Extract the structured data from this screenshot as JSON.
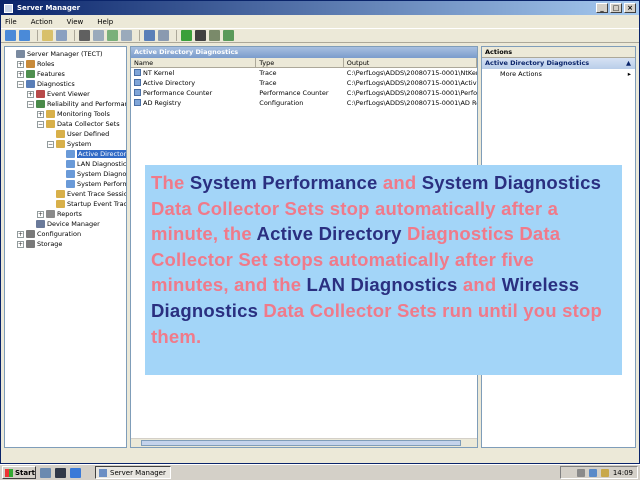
{
  "window": {
    "title": "Server Manager"
  },
  "menu": [
    "File",
    "Action",
    "View",
    "Help"
  ],
  "tree": [
    {
      "label": "Server Manager (TECT)",
      "indent": 0,
      "exp": "",
      "icon": "#7a8aa0"
    },
    {
      "label": "Roles",
      "indent": 1,
      "exp": "+",
      "icon": "#c88a3a"
    },
    {
      "label": "Features",
      "indent": 1,
      "exp": "+",
      "icon": "#4f8f4f"
    },
    {
      "label": "Diagnostics",
      "indent": 1,
      "exp": "-",
      "icon": "#5a7fb8"
    },
    {
      "label": "Event Viewer",
      "indent": 2,
      "exp": "+",
      "icon": "#b84a4a"
    },
    {
      "label": "Reliability and Performance",
      "indent": 2,
      "exp": "-",
      "icon": "#4a8a4a"
    },
    {
      "label": "Monitoring Tools",
      "indent": 3,
      "exp": "+",
      "icon": "#d8b04a"
    },
    {
      "label": "Data Collector Sets",
      "indent": 3,
      "exp": "-",
      "icon": "#d8b04a"
    },
    {
      "label": "User Defined",
      "indent": 4,
      "exp": "",
      "icon": "#d8b04a"
    },
    {
      "label": "System",
      "indent": 4,
      "exp": "-",
      "icon": "#d8b04a"
    },
    {
      "label": "Active Directory",
      "indent": 5,
      "exp": "",
      "icon": "#6a9ad8",
      "selected": true
    },
    {
      "label": "LAN Diagnostics",
      "indent": 5,
      "exp": "",
      "icon": "#6a9ad8"
    },
    {
      "label": "System Diagnostics",
      "indent": 5,
      "exp": "",
      "icon": "#6a9ad8"
    },
    {
      "label": "System Performance",
      "indent": 5,
      "exp": "",
      "icon": "#6a9ad8"
    },
    {
      "label": "Event Trace Sessions",
      "indent": 4,
      "exp": "",
      "icon": "#d8b04a"
    },
    {
      "label": "Startup Event Trace Sessions",
      "indent": 4,
      "exp": "",
      "icon": "#d8b04a"
    },
    {
      "label": "Reports",
      "indent": 3,
      "exp": "+",
      "icon": "#8a8a8a"
    },
    {
      "label": "Device Manager",
      "indent": 2,
      "exp": "",
      "icon": "#6a7a9a"
    },
    {
      "label": "Configuration",
      "indent": 1,
      "exp": "+",
      "icon": "#7a7a7a"
    },
    {
      "label": "Storage",
      "indent": 1,
      "exp": "+",
      "icon": "#7a7a7a"
    }
  ],
  "center": {
    "header": "Active Directory Diagnostics",
    "columns": [
      "Name",
      "Type",
      "Output"
    ],
    "rows": [
      {
        "name": "NT Kernel",
        "type": "Trace",
        "output": "C:\\PerfLogs\\ADDS\\20080715-0001\\NtKernel..."
      },
      {
        "name": "Active Directory",
        "type": "Trace",
        "output": "C:\\PerfLogs\\ADDS\\20080715-0001\\Active Di..."
      },
      {
        "name": "Performance Counter",
        "type": "Performance Counter",
        "output": "C:\\PerfLogs\\ADDS\\20080715-0001\\Perform..."
      },
      {
        "name": "AD Registry",
        "type": "Configuration",
        "output": "C:\\PerfLogs\\ADDS\\20080715-0001\\AD Regis..."
      }
    ]
  },
  "actions": {
    "header": "Actions",
    "sub": "Active Directory Diagnostics",
    "item": "More Actions"
  },
  "overlay": {
    "p1": "The ",
    "n1": "System Performance",
    "p2": " and ",
    "n2": "System Diagnostics",
    "p3": " Data Collector Sets stop automatically after a minute, the ",
    "n3": "Active Directory",
    "p4": " Diagnostics Data Collector Set stops automatically after five minutes, and the ",
    "n4": "LAN Diagnostics",
    "p5": " and ",
    "n5": "Wireless Diagnostics",
    "p6": " Data Collector Sets run until you stop them."
  },
  "taskbar": {
    "start": "Start",
    "task": "Server Manager",
    "clock": "14:09"
  },
  "colors": {
    "overlay_bg": "#a3d5f8",
    "pink": "#f07a8a",
    "navy": "#2a2f80"
  }
}
